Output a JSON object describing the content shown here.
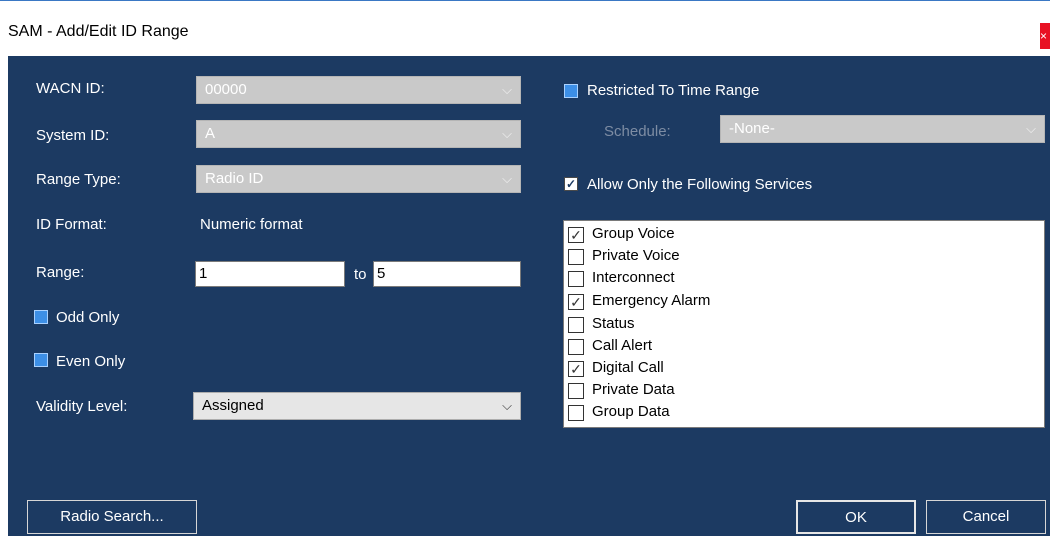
{
  "window": {
    "title": "SAM - Add/Edit ID Range",
    "close_glyph": "×"
  },
  "left": {
    "wacn_label": "WACN ID:",
    "wacn_value": "00000",
    "system_label": "System ID:",
    "system_value": "A",
    "range_type_label": "Range Type:",
    "range_type_value": "Radio ID",
    "id_format_label": "ID Format:",
    "id_format_value": "Numeric format",
    "range_label": "Range:",
    "range_from": "1",
    "range_to_label": "to",
    "range_to": "5",
    "odd_only": "Odd Only",
    "even_only": "Even Only",
    "validity_label": "Validity Level:",
    "validity_value": "Assigned"
  },
  "right": {
    "restricted_label": "Restricted To Time Range",
    "schedule_label": "Schedule:",
    "schedule_value": "-None-",
    "allow_services_label": "Allow Only the Following Services",
    "services": [
      {
        "label": "Group Voice",
        "checked": true
      },
      {
        "label": "Private Voice",
        "checked": false
      },
      {
        "label": "Interconnect",
        "checked": false
      },
      {
        "label": "Emergency Alarm",
        "checked": true
      },
      {
        "label": "Status",
        "checked": false
      },
      {
        "label": "Call Alert",
        "checked": false
      },
      {
        "label": "Digital Call",
        "checked": true
      },
      {
        "label": "Private Data",
        "checked": false
      },
      {
        "label": "Group Data",
        "checked": false
      }
    ]
  },
  "buttons": {
    "radio_search": "Radio Search...",
    "ok": "OK",
    "cancel": "Cancel"
  },
  "glyphs": {
    "chevron": "⌵",
    "check": "✓"
  }
}
